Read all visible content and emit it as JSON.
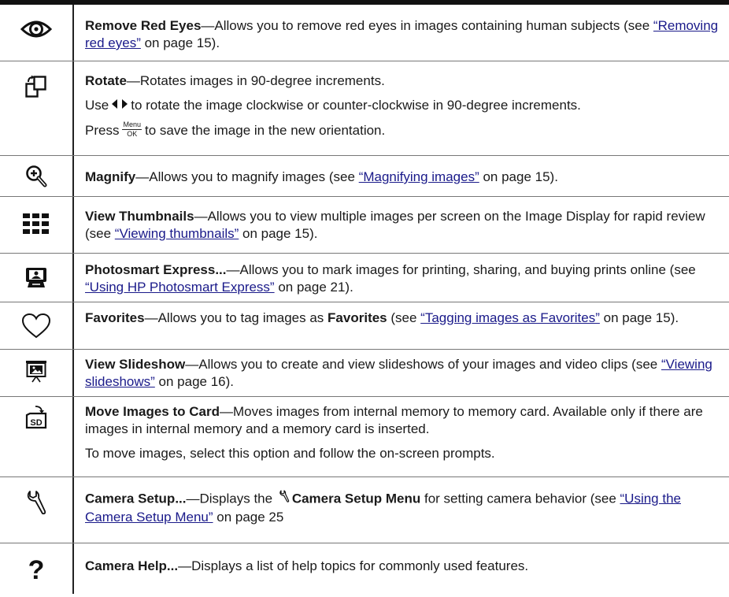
{
  "rows": [
    {
      "icon": "eye-icon",
      "title": "Remove Red Eyes",
      "desc": "—Allows you to remove red eyes in images containing human subjects (see ",
      "link": "“Removing red eyes”",
      "page": " on page 15)."
    },
    {
      "icon": "rotate-icon",
      "title": "Rotate",
      "desc": "—Rotates images in 90-degree increments.",
      "line2_before": "Use",
      "line2_after": "to rotate the image clockwise or counter-clockwise in 90-degree increments.",
      "line3_before": "Press",
      "menu_top": "Menu",
      "menu_bottom": "OK",
      "line3_after": "to save the image in the new orientation."
    },
    {
      "icon": "magnify-icon",
      "title": "Magnify",
      "desc": "—Allows you to magnify images (see ",
      "link": "“Magnifying images”",
      "page": " on page 15)."
    },
    {
      "icon": "thumbnails-icon",
      "title": "View Thumbnails",
      "desc": "—Allows you to view multiple images per screen on the Image Display for rapid review (see ",
      "link": "“Viewing thumbnails”",
      "page": " on page 15)."
    },
    {
      "icon": "photosmart-express-icon",
      "title": "Photosmart Express...",
      "desc": "—Allows you to mark images for printing, sharing, and buying prints online (see ",
      "link": "“Using HP Photosmart Express”",
      "page": " on page 21)."
    },
    {
      "icon": "heart-icon",
      "title": "Favorites",
      "desc": "—Allows you to tag images as ",
      "desc_bold": "Favorites",
      "desc2": " (see ",
      "link": "“Tagging images as Favorites”",
      "page": " on page 15)."
    },
    {
      "icon": "slideshow-icon",
      "title": "View Slideshow",
      "desc": "—Allows you to create and view slideshows of your images and video clips (see ",
      "link": "“Viewing slideshows”",
      "page": " on page 16)."
    },
    {
      "icon": "sd-card-icon",
      "title": "Move Images to Card",
      "desc": "—Moves images from internal memory to memory card. Available only if there are images in internal memory and a memory card is inserted.",
      "line2": "To move images, select this option and follow the on-screen prompts."
    },
    {
      "icon": "wrench-icon",
      "title": "Camera Setup...",
      "desc": "—Displays the ",
      "desc_bold": "Camera Setup Menu",
      "desc2": " for setting camera behavior (see ",
      "link": "“Using the Camera Setup Menu”",
      "page": " on page 25"
    },
    {
      "icon": "help-icon",
      "title": "Camera Help...",
      "desc": "—Displays a list of help topics for commonly used features."
    }
  ]
}
